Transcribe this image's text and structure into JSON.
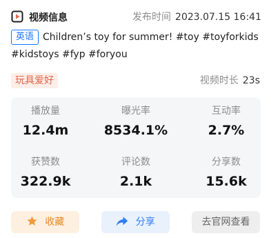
{
  "header": {
    "title": "视频信息",
    "title_icon": "video-icon",
    "publish_label": "发布时间",
    "publish_time": "2023.07.15 16:41"
  },
  "description": {
    "language_tag": "英语",
    "text": "Children’s toy for summer! #toy #toyforkids #kidstoys #fyp #foryou"
  },
  "category": "玩具爱好",
  "duration": {
    "label": "视频时长",
    "value": "23s"
  },
  "stats": [
    {
      "label": "播放量",
      "value": "12.4m"
    },
    {
      "label": "曝光率",
      "value": "8534.1%"
    },
    {
      "label": "互动率",
      "value": "2.7%"
    },
    {
      "label": "获赞数",
      "value": "322.9k"
    },
    {
      "label": "评论数",
      "value": "2.1k"
    },
    {
      "label": "分享数",
      "value": "15.6k"
    }
  ],
  "actions": {
    "favorite_label": "收藏",
    "favorite_icon": "star-icon",
    "share_label": "分享",
    "share_icon": "share-arrow-icon",
    "site_label": "去官网查看"
  },
  "colors": {
    "accent_blue": "#1677ff",
    "category_red": "#e0654a",
    "favorite_orange": "#e98a24"
  }
}
